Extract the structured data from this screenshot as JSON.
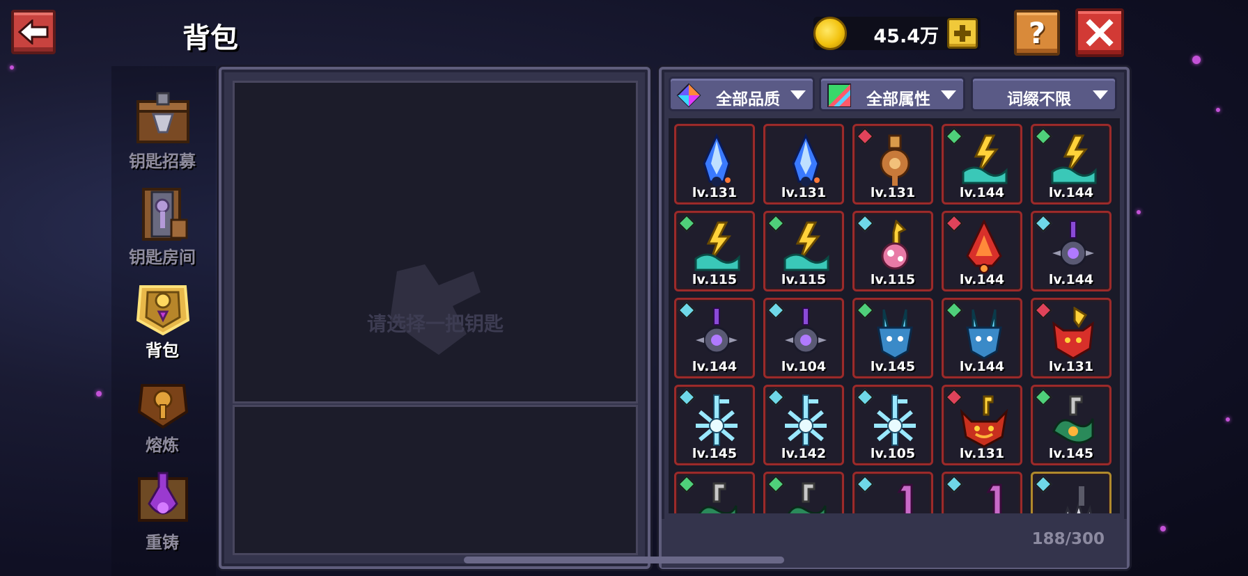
{
  "header": {
    "title": "背包",
    "coins": "45.4万",
    "help_label": "?"
  },
  "sidebar": {
    "items": [
      {
        "label": "钥匙招募",
        "icon": "key-recruit-chest-icon",
        "active": false
      },
      {
        "label": "钥匙房间",
        "icon": "key-room-scroll-icon",
        "active": false
      },
      {
        "label": "背包",
        "icon": "backpack-key-icon",
        "active": true
      },
      {
        "label": "熔炼",
        "icon": "smelt-lock-icon",
        "active": false
      },
      {
        "label": "重铸",
        "icon": "recast-potion-icon",
        "active": false
      }
    ]
  },
  "left_panel": {
    "hint": "请选择一把钥匙"
  },
  "filters": {
    "quality": "全部品质",
    "attribute": "全部属性",
    "affix": "词缀不限"
  },
  "inventory": {
    "capacity": "188/300",
    "colors": {
      "rare_border": "#9c2a2a",
      "legend_border": "#b08a2c"
    },
    "items": [
      {
        "level": "lv.131",
        "gem": "",
        "art": "blue-crystal-key"
      },
      {
        "level": "lv.131",
        "gem": "",
        "art": "blue-crystal-key"
      },
      {
        "level": "lv.131",
        "gem": "red",
        "art": "bronze-gear-key"
      },
      {
        "level": "lv.144",
        "gem": "green",
        "art": "lightning-wave-key"
      },
      {
        "level": "lv.144",
        "gem": "green",
        "art": "lightning-wave-key"
      },
      {
        "level": "lv.115",
        "gem": "green",
        "art": "lightning-wave-key"
      },
      {
        "level": "lv.115",
        "gem": "green",
        "art": "lightning-wave-key"
      },
      {
        "level": "lv.115",
        "gem": "cyan",
        "art": "pink-flower-key"
      },
      {
        "level": "lv.144",
        "gem": "red",
        "art": "red-flame-key"
      },
      {
        "level": "lv.144",
        "gem": "cyan",
        "art": "purple-orb-key"
      },
      {
        "level": "lv.144",
        "gem": "cyan",
        "art": "purple-orb-key"
      },
      {
        "level": "lv.104",
        "gem": "cyan",
        "art": "purple-orb-key"
      },
      {
        "level": "lv.145",
        "gem": "green",
        "art": "teal-horn-key"
      },
      {
        "level": "lv.144",
        "gem": "green",
        "art": "teal-horn-key"
      },
      {
        "level": "lv.131",
        "gem": "red",
        "art": "red-demon-key"
      },
      {
        "level": "lv.145",
        "gem": "cyan",
        "art": "ice-snowflake-key"
      },
      {
        "level": "lv.142",
        "gem": "cyan",
        "art": "ice-snowflake-key"
      },
      {
        "level": "lv.105",
        "gem": "cyan",
        "art": "ice-snowflake-key"
      },
      {
        "level": "lv.131",
        "gem": "red",
        "art": "fire-demon-key"
      },
      {
        "level": "lv.145",
        "gem": "green",
        "art": "green-snake-key"
      },
      {
        "level": "",
        "gem": "green",
        "art": "green-snake-key"
      },
      {
        "level": "",
        "gem": "green",
        "art": "green-snake-key"
      },
      {
        "level": "",
        "gem": "cyan",
        "art": "purple-hook-key"
      },
      {
        "level": "",
        "gem": "cyan",
        "art": "purple-hook-key"
      },
      {
        "level": "",
        "gem": "cyan",
        "art": "silver-claw-key",
        "gold": true
      }
    ]
  },
  "gem_colors": {
    "red": "#e0435a",
    "green": "#4fd07a",
    "cyan": "#6fd8e8"
  }
}
